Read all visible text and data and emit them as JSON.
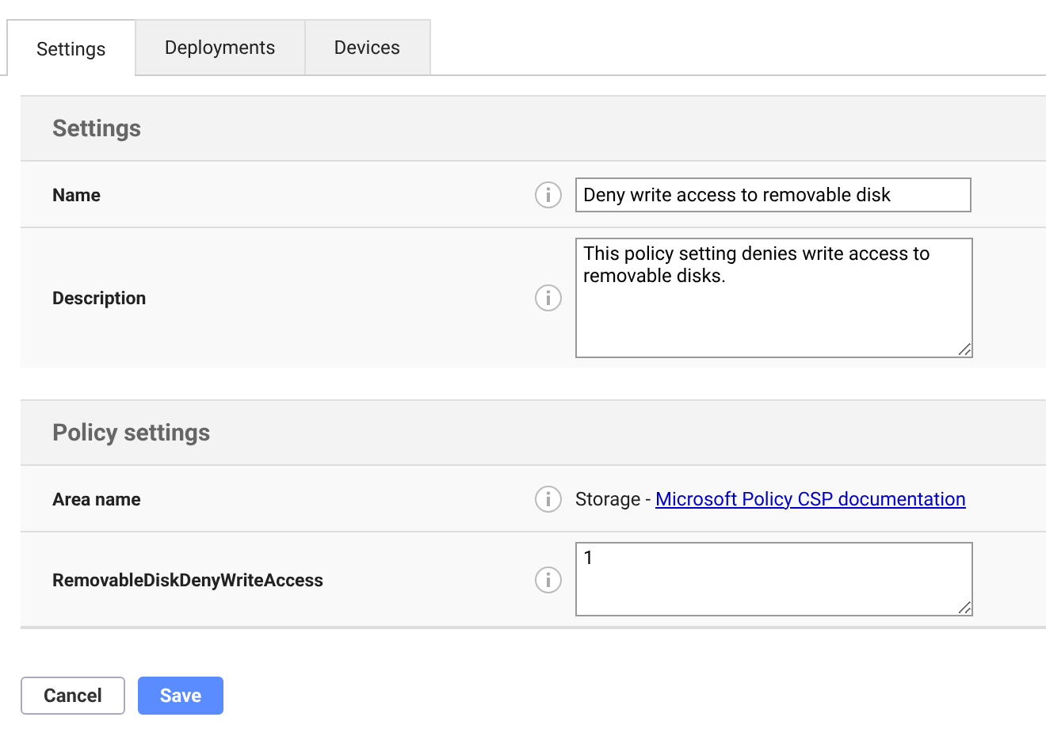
{
  "tabs": [
    {
      "label": "Settings",
      "selected": true
    },
    {
      "label": "Deployments",
      "selected": false
    },
    {
      "label": "Devices",
      "selected": false
    }
  ],
  "sections": [
    {
      "title": "Settings",
      "rows": [
        {
          "kind": "input",
          "label": "Name",
          "value": "Deny write access to removable disk"
        },
        {
          "kind": "textarea",
          "label": "Description",
          "value": "This policy setting denies write access to removable disks."
        }
      ]
    },
    {
      "title": "Policy settings",
      "rows": [
        {
          "kind": "link",
          "label": "Area name",
          "prefix": "Storage - ",
          "link": "Microsoft Policy CSP documentation"
        },
        {
          "kind": "textarea-small",
          "label": "RemovableDiskDenyWriteAccess",
          "value": "1"
        }
      ]
    }
  ],
  "buttons": [
    {
      "label": "Cancel",
      "kind": "secondary"
    },
    {
      "label": "Save",
      "kind": "primary"
    }
  ]
}
